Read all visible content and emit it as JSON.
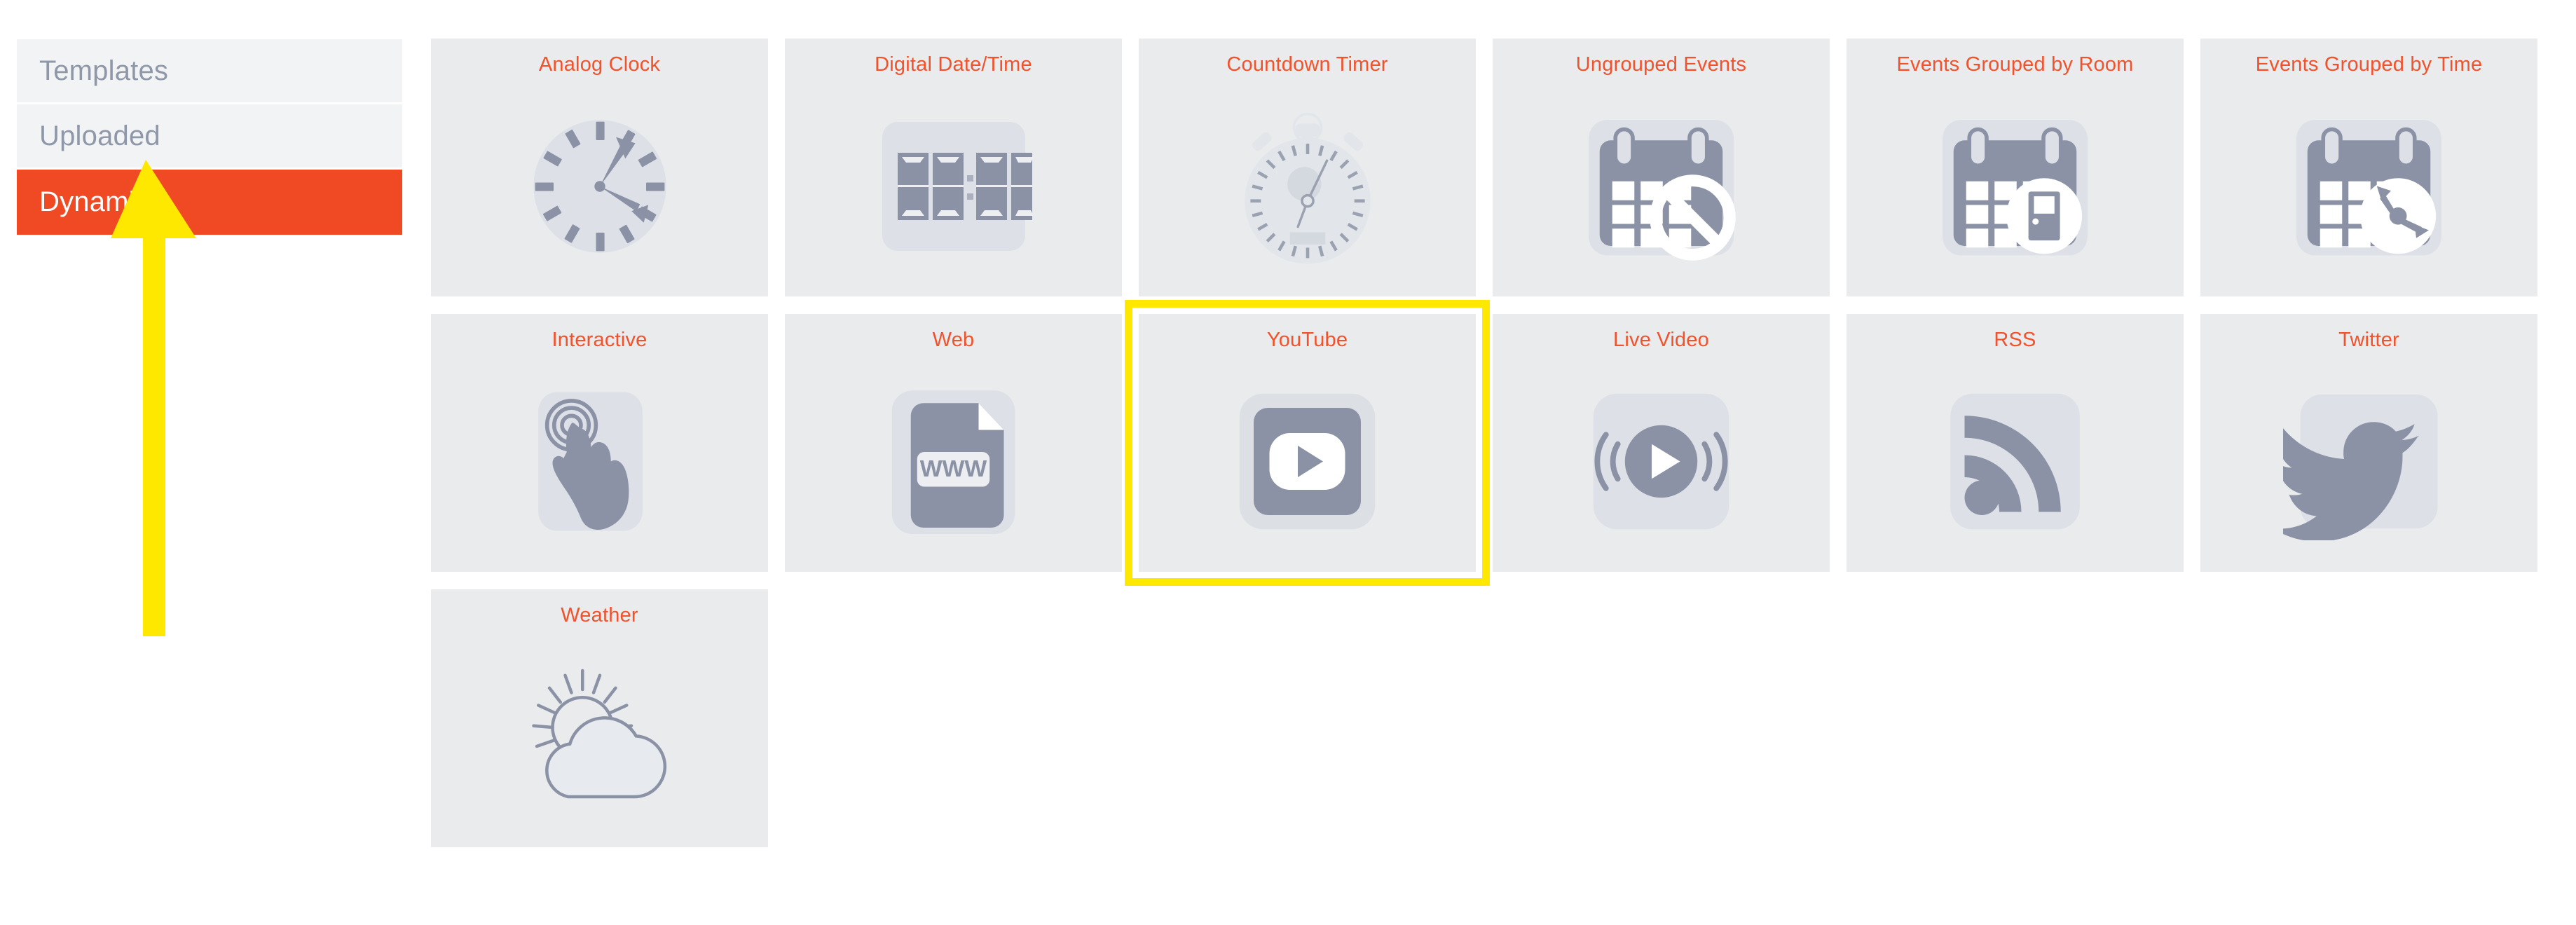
{
  "sidebar": {
    "items": [
      {
        "label": "Templates",
        "state": "inactive",
        "name": "sidebar-item-templates"
      },
      {
        "label": "Uploaded",
        "state": "inactive",
        "name": "sidebar-item-uploaded"
      },
      {
        "label": "Dynamic",
        "state": "active",
        "name": "sidebar-item-dynamic"
      }
    ],
    "active_color": "#ef4a23",
    "inactive_bg": "#f1f3f5",
    "inactive_text": "#8f98a8"
  },
  "annotation": {
    "type": "arrow",
    "color": "#ffe800",
    "points_to": "sidebar-item-dynamic"
  },
  "highlight": {
    "color": "#ffe800",
    "target": "YouTube"
  },
  "grid": {
    "label_color": "#f2522b",
    "card_bg": "#e9ebed",
    "icon_color": "#8b92a5",
    "icon_plate": "#dcdfe4",
    "rows": [
      [
        {
          "label": "Analog Clock",
          "icon": "analog-clock-icon",
          "highlighted": false
        },
        {
          "label": "Digital Date/Time",
          "icon": "digital-clock-icon",
          "highlighted": false
        },
        {
          "label": "Countdown Timer",
          "icon": "stopwatch-icon",
          "highlighted": false
        },
        {
          "label": "Ungrouped Events",
          "icon": "calendar-blocked-icon",
          "highlighted": false
        },
        {
          "label": "Events Grouped by Room",
          "icon": "calendar-door-icon",
          "highlighted": false
        },
        {
          "label": "Events Grouped by Time",
          "icon": "calendar-clock-icon",
          "highlighted": false
        }
      ],
      [
        {
          "label": "Interactive",
          "icon": "touch-hand-icon",
          "highlighted": false
        },
        {
          "label": "Web",
          "icon": "www-document-icon",
          "highlighted": false
        },
        {
          "label": "YouTube",
          "icon": "youtube-icon",
          "highlighted": true
        },
        {
          "label": "Live Video",
          "icon": "live-video-icon",
          "highlighted": false
        },
        {
          "label": "RSS",
          "icon": "rss-icon",
          "highlighted": false
        },
        {
          "label": "Twitter",
          "icon": "twitter-bird-icon",
          "highlighted": false
        }
      ],
      [
        {
          "label": "Weather",
          "icon": "weather-sun-cloud-icon",
          "highlighted": false
        }
      ]
    ]
  },
  "digital_clock": {
    "display": "00:00"
  },
  "web_card": {
    "document_text": "WWW"
  }
}
